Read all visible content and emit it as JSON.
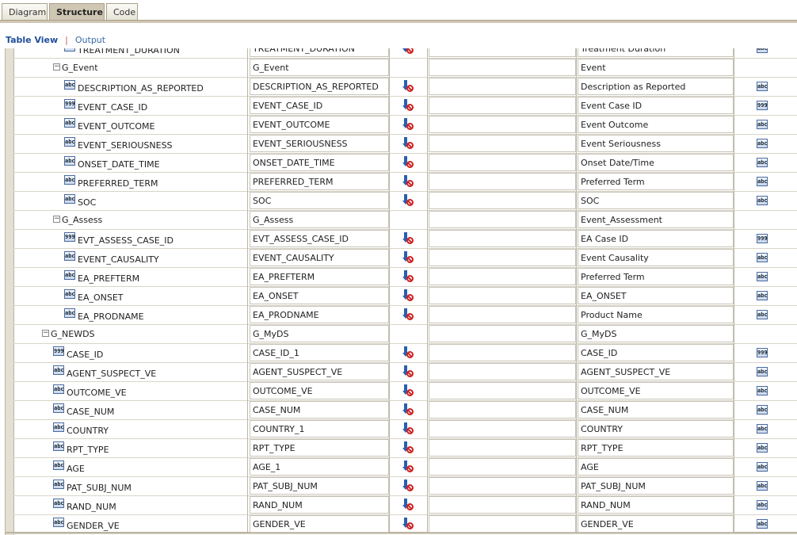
{
  "tabs": [
    {
      "label": "Diagram",
      "active": false
    },
    {
      "label": "Structure",
      "active": true
    },
    {
      "label": "Code",
      "active": false
    }
  ],
  "subnav": {
    "table_view": "Table View",
    "output": "Output"
  },
  "rows": [
    {
      "name": "TREATMENT_DURATION",
      "kind": "field",
      "icon": "abc",
      "level": 3,
      "src": "TREATMENT_DURATION",
      "sort": true,
      "display": "Treatment Duration",
      "dtype": "abc",
      "partial": true
    },
    {
      "name": "G_Event",
      "kind": "group",
      "level": 2,
      "src": "G_Event",
      "sort": false,
      "display": "Event",
      "dtype": ""
    },
    {
      "name": "DESCRIPTION_AS_REPORTED",
      "kind": "field",
      "icon": "abc",
      "level": 3,
      "src": "DESCRIPTION_AS_REPORTED",
      "sort": true,
      "display": "Description as Reported",
      "dtype": "abc"
    },
    {
      "name": "EVENT_CASE_ID",
      "kind": "field",
      "icon": "999",
      "level": 3,
      "src": "EVENT_CASE_ID",
      "sort": true,
      "display": "Event Case ID",
      "dtype": "999"
    },
    {
      "name": "EVENT_OUTCOME",
      "kind": "field",
      "icon": "abc",
      "level": 3,
      "src": "EVENT_OUTCOME",
      "sort": true,
      "display": "Event Outcome",
      "dtype": "abc"
    },
    {
      "name": "EVENT_SERIOUSNESS",
      "kind": "field",
      "icon": "abc",
      "level": 3,
      "src": "EVENT_SERIOUSNESS",
      "sort": true,
      "display": "Event Seriousness",
      "dtype": "abc"
    },
    {
      "name": "ONSET_DATE_TIME",
      "kind": "field",
      "icon": "abc",
      "level": 3,
      "src": "ONSET_DATE_TIME",
      "sort": true,
      "display": "Onset Date/Time",
      "dtype": "abc"
    },
    {
      "name": "PREFERRED_TERM",
      "kind": "field",
      "icon": "abc",
      "level": 3,
      "src": "PREFERRED_TERM",
      "sort": true,
      "display": "Preferred Term",
      "dtype": "abc"
    },
    {
      "name": "SOC",
      "kind": "field",
      "icon": "abc",
      "level": 3,
      "src": "SOC",
      "sort": true,
      "display": "SOC",
      "dtype": "abc"
    },
    {
      "name": "G_Assess",
      "kind": "group",
      "level": 2,
      "src": "G_Assess",
      "sort": false,
      "display": "Event_Assessment",
      "dtype": ""
    },
    {
      "name": "EVT_ASSESS_CASE_ID",
      "kind": "field",
      "icon": "999",
      "level": 3,
      "src": "EVT_ASSESS_CASE_ID",
      "sort": true,
      "display": "EA Case ID",
      "dtype": "999"
    },
    {
      "name": "EVENT_CAUSALITY",
      "kind": "field",
      "icon": "abc",
      "level": 3,
      "src": "EVENT_CAUSALITY",
      "sort": true,
      "display": "Event Causality",
      "dtype": "abc"
    },
    {
      "name": "EA_PREFTERM",
      "kind": "field",
      "icon": "abc",
      "level": 3,
      "src": "EA_PREFTERM",
      "sort": true,
      "display": "Preferred Term",
      "dtype": "abc"
    },
    {
      "name": "EA_ONSET",
      "kind": "field",
      "icon": "abc",
      "level": 3,
      "src": "EA_ONSET",
      "sort": true,
      "display": "EA_ONSET",
      "dtype": "abc"
    },
    {
      "name": "EA_PRODNAME",
      "kind": "field",
      "icon": "abc",
      "level": 3,
      "src": "EA_PRODNAME",
      "sort": true,
      "display": "Product Name",
      "dtype": "abc"
    },
    {
      "name": "G_NEWDS",
      "kind": "group",
      "level": 1,
      "src": "G_MyDS",
      "sort": false,
      "display": "G_MyDS",
      "dtype": ""
    },
    {
      "name": "CASE_ID",
      "kind": "field",
      "icon": "999",
      "level": 2,
      "src": "CASE_ID_1",
      "sort": true,
      "display": "CASE_ID",
      "dtype": "999"
    },
    {
      "name": "AGENT_SUSPECT_VE",
      "kind": "field",
      "icon": "abc",
      "level": 2,
      "src": "AGENT_SUSPECT_VE",
      "sort": true,
      "display": "AGENT_SUSPECT_VE",
      "dtype": "abc"
    },
    {
      "name": "OUTCOME_VE",
      "kind": "field",
      "icon": "abc",
      "level": 2,
      "src": "OUTCOME_VE",
      "sort": true,
      "display": "OUTCOME_VE",
      "dtype": "abc"
    },
    {
      "name": "CASE_NUM",
      "kind": "field",
      "icon": "abc",
      "level": 2,
      "src": "CASE_NUM",
      "sort": true,
      "display": "CASE_NUM",
      "dtype": "abc"
    },
    {
      "name": "COUNTRY",
      "kind": "field",
      "icon": "abc",
      "level": 2,
      "src": "COUNTRY_1",
      "sort": true,
      "display": "COUNTRY",
      "dtype": "abc"
    },
    {
      "name": "RPT_TYPE",
      "kind": "field",
      "icon": "abc",
      "level": 2,
      "src": "RPT_TYPE",
      "sort": true,
      "display": "RPT_TYPE",
      "dtype": "abc"
    },
    {
      "name": "AGE",
      "kind": "field",
      "icon": "abc",
      "level": 2,
      "src": "AGE_1",
      "sort": true,
      "display": "AGE",
      "dtype": "abc"
    },
    {
      "name": "PAT_SUBJ_NUM",
      "kind": "field",
      "icon": "abc",
      "level": 2,
      "src": "PAT_SUBJ_NUM",
      "sort": true,
      "display": "PAT_SUBJ_NUM",
      "dtype": "abc"
    },
    {
      "name": "RAND_NUM",
      "kind": "field",
      "icon": "abc",
      "level": 2,
      "src": "RAND_NUM",
      "sort": true,
      "display": "RAND_NUM",
      "dtype": "abc"
    },
    {
      "name": "GENDER_VE",
      "kind": "field",
      "icon": "abc",
      "level": 2,
      "src": "GENDER_VE",
      "sort": true,
      "display": "GENDER_VE",
      "dtype": "abc"
    }
  ]
}
